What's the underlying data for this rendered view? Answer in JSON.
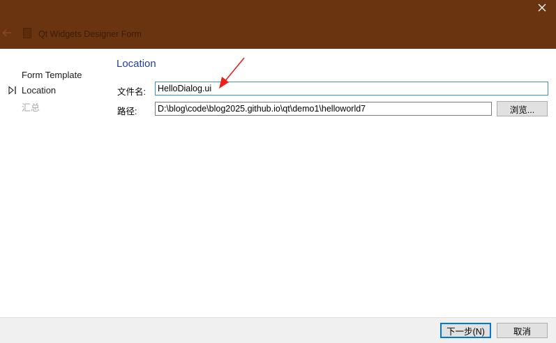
{
  "window": {
    "title": "Qt Widgets Designer Form",
    "accent_color": "#6b3410"
  },
  "nav": {
    "items": [
      {
        "label": "Form Template",
        "state": "done"
      },
      {
        "label": "Location",
        "state": "current"
      },
      {
        "label": "汇总",
        "state": "disabled"
      }
    ]
  },
  "page": {
    "heading": "Location",
    "file_name": {
      "label": "文件名:",
      "value": "HelloDialog.ui"
    },
    "path": {
      "label": "路径:",
      "value": "D:\\blog\\code\\blog2025.github.io\\qt\\demo1\\helloworld7"
    },
    "browse_label": "浏览..."
  },
  "footer": {
    "next_label": "下一步(N)",
    "cancel_label": "取消"
  },
  "annotation": {
    "arrow_color": "#e8211b"
  }
}
